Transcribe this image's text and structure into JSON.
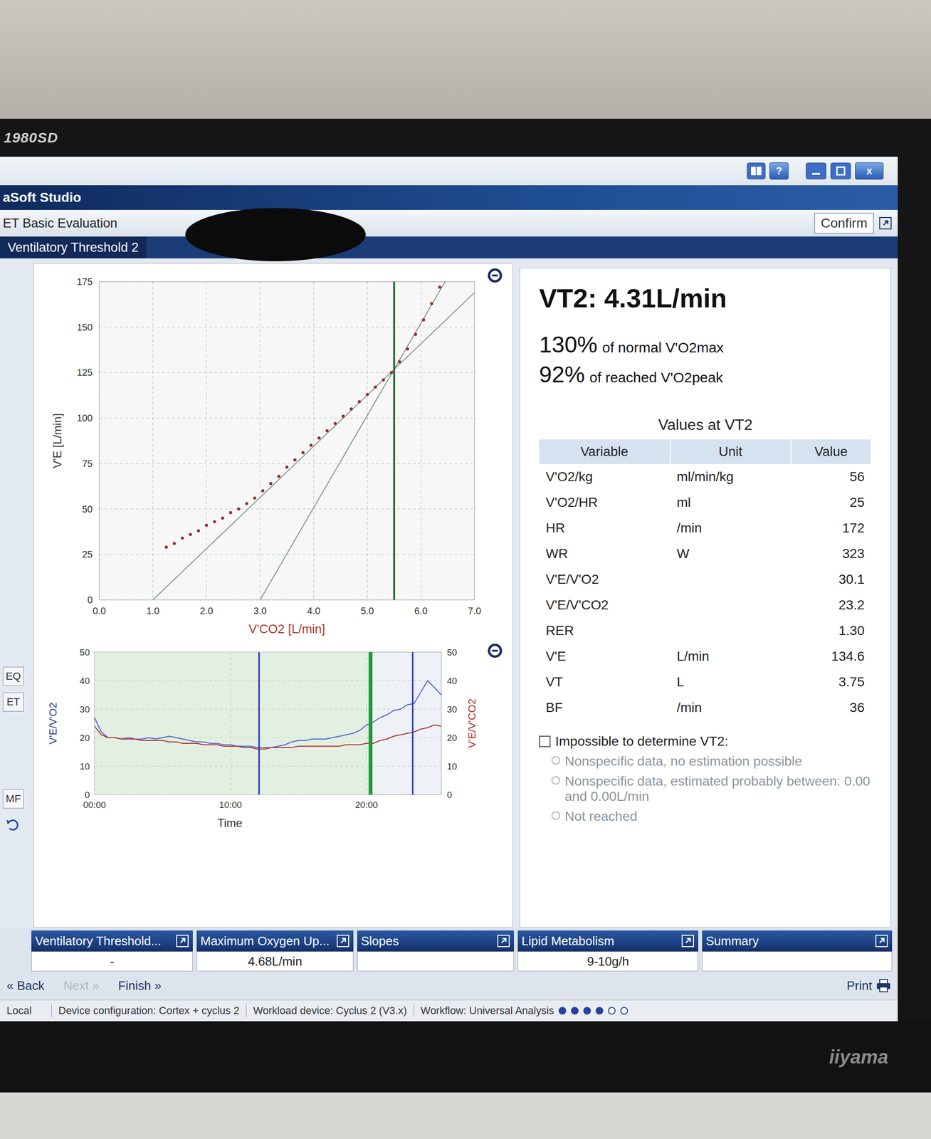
{
  "monitor": {
    "model": "1980SD",
    "brand": "iiyama"
  },
  "window": {
    "controls": [
      "?",
      "x"
    ],
    "title": "aSoft Studio",
    "subtitle": "ET Basic Evaluation",
    "confirm": "Confirm"
  },
  "side_buttons": [
    {
      "label": "EQ"
    },
    {
      "label": "ET"
    },
    {
      "label": "MF"
    }
  ],
  "panel": {
    "title": "Ventilatory Threshold 2"
  },
  "chart1": {
    "x_label": "V'CO2 [L/min]",
    "y_label": "V'E [L/min]",
    "x_ticks": [
      "0.0",
      "1.0",
      "2.0",
      "3.0",
      "4.0",
      "5.0",
      "6.0",
      "7.0"
    ],
    "y_ticks": [
      "0",
      "25",
      "50",
      "75",
      "100",
      "125",
      "150",
      "175"
    ],
    "points": {
      "color": "#9c2a22",
      "x": [
        1.25,
        1.4,
        1.55,
        1.7,
        1.85,
        2.0,
        2.15,
        2.3,
        2.45,
        2.6,
        2.75,
        2.9,
        3.05,
        3.2,
        3.35,
        3.5,
        3.65,
        3.8,
        3.95,
        4.1,
        4.25,
        4.4,
        4.55,
        4.7,
        4.85,
        5.0,
        5.15,
        5.3,
        5.45,
        5.6,
        5.75,
        5.9,
        6.05,
        6.2,
        6.35
      ],
      "y": [
        29,
        31,
        34,
        36,
        38,
        41,
        43,
        45,
        48,
        50,
        53,
        56,
        60,
        64,
        68,
        73,
        77,
        81,
        85,
        89,
        93,
        97,
        101,
        105,
        109,
        113,
        117,
        121,
        125,
        131,
        138,
        146,
        154,
        163,
        172
      ]
    },
    "fit_lines": [
      {
        "x": [
          1.0,
          7.0
        ],
        "y": [
          0,
          169
        ]
      },
      {
        "x": [
          3.0,
          6.45
        ],
        "y": [
          0,
          175
        ]
      }
    ],
    "threshold": {
      "x": 5.5,
      "color": "#1d6b2a"
    }
  },
  "chart2": {
    "y_left_label": "V'E/V'O2",
    "y_right_label": "V'E/V'CO2",
    "x_label": "Time",
    "x_ticks": [
      "00:00",
      "10:00",
      "20:00"
    ],
    "y_left_ticks": [
      "0",
      "10",
      "20",
      "30",
      "40",
      "50"
    ],
    "y_right_ticks": [
      "0",
      "10",
      "20",
      "30",
      "40",
      "50"
    ],
    "time_step_min": 0.5,
    "series": [
      {
        "name": "V'E/V'O2",
        "color": "#4a62d8",
        "values": [
          27,
          22,
          20,
          20,
          19.5,
          20,
          19.5,
          19.5,
          20,
          19.5,
          20,
          20.5,
          20,
          19.5,
          19,
          18.5,
          18.5,
          18,
          18,
          17.5,
          17.5,
          17,
          17,
          17,
          16.5,
          16.5,
          16.5,
          17,
          17.5,
          18.5,
          19,
          19,
          19.5,
          19.5,
          19.5,
          20,
          20.5,
          21,
          21.5,
          22.5,
          24.5,
          25.5,
          27,
          28,
          29.5,
          30,
          31.5,
          32,
          36,
          40,
          37.5,
          35
        ]
      },
      {
        "name": "V'E/V'CO2",
        "color": "#b03030",
        "values": [
          24,
          21,
          20,
          20,
          19.5,
          19.5,
          19.5,
          19,
          19,
          19,
          19,
          18.5,
          18.5,
          18,
          18,
          18,
          17.5,
          17.5,
          17.5,
          17,
          17,
          17,
          16.5,
          16.5,
          16,
          16,
          16.5,
          16.5,
          16.5,
          16.5,
          17,
          17,
          17,
          17,
          17,
          17,
          17,
          17.5,
          17.5,
          17.5,
          18,
          18,
          19,
          19.5,
          20.5,
          21,
          21.5,
          22,
          23,
          23.5,
          24.5,
          24
        ]
      }
    ],
    "markers": [
      {
        "t": 12.1,
        "color": "#2433c8",
        "selected": false
      },
      {
        "t": 20.3,
        "color": "#1e9a3a",
        "selected": true
      },
      {
        "t": 23.4,
        "color": "#2433c8",
        "selected": false
      }
    ]
  },
  "result": {
    "headline": "VT2: 4.31L/min",
    "lines": [
      {
        "value": "130%",
        "text": "of normal V'O2max"
      },
      {
        "value": "92%",
        "text": "of reached V'O2peak"
      }
    ]
  },
  "table": {
    "caption": "Values at VT2",
    "columns": [
      "Variable",
      "Unit",
      "Value"
    ],
    "rows": [
      [
        "V'O2/kg",
        "ml/min/kg",
        "56"
      ],
      [
        "V'O2/HR",
        "ml",
        "25"
      ],
      [
        "HR",
        "/min",
        "172"
      ],
      [
        "WR",
        "W",
        "323"
      ],
      [
        "V'E/V'O2",
        "",
        "30.1"
      ],
      [
        "V'E/V'CO2",
        "",
        "23.2"
      ],
      [
        "RER",
        "",
        "1.30"
      ],
      [
        "V'E",
        "L/min",
        "134.6"
      ],
      [
        "VT",
        "L",
        "3.75"
      ],
      [
        "BF",
        "/min",
        "36"
      ]
    ]
  },
  "impossible": {
    "label": "Impossible to determine VT2:",
    "checked": false,
    "options": [
      {
        "label": "Nonspecific data, no estimation possible",
        "selected": false,
        "disabled": true
      },
      {
        "label": "Nonspecific data, estimated probably between: 0.00 and 0.00L/min",
        "selected": false,
        "disabled": true
      },
      {
        "label": "Not reached",
        "selected": false,
        "disabled": true
      }
    ]
  },
  "cards": [
    {
      "title": "Ventilatory Threshold...",
      "value": "-"
    },
    {
      "title": "Maximum Oxygen Up...",
      "value": "4.68L/min"
    },
    {
      "title": "Slopes"
    },
    {
      "title": "Lipid Metabolism",
      "value": "9-10g/h"
    },
    {
      "title": "Summary"
    }
  ],
  "nav": {
    "back": "« Back",
    "next": {
      "label": "Next »",
      "disabled": true
    },
    "finish": "Finish »",
    "print": "Print"
  },
  "status_bar": {
    "items": [
      "Local",
      "Device configuration: Cortex + cyclus 2",
      "Workload device: Cyclus 2 (V3.x)",
      "Workflow: Universal Analysis"
    ],
    "steps": [
      {
        "done": true
      },
      {
        "done": true
      },
      {
        "done": true
      },
      {
        "done": true
      },
      {
        "done": false
      },
      {
        "done": false
      }
    ]
  }
}
